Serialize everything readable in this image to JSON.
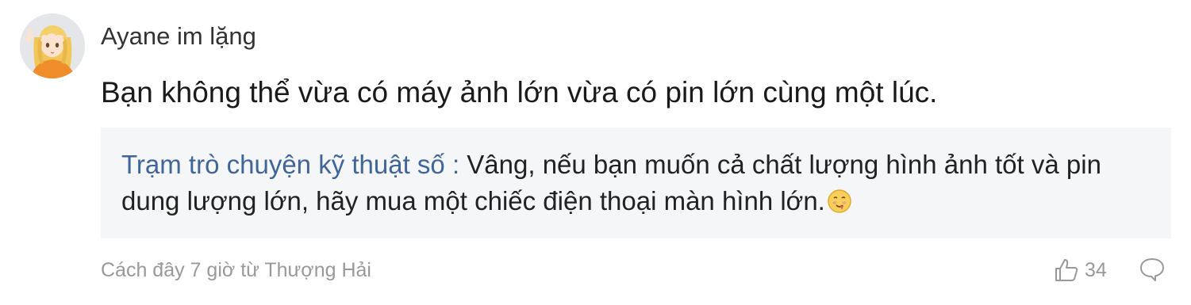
{
  "comment": {
    "username": "Ayane im lặng",
    "text": "Bạn không thể vừa có máy ảnh lớn vừa có pin lớn cùng một lúc.",
    "avatar_icon": "anime-girl-avatar",
    "reply": {
      "author": "Trạm trò chuyện kỹ thuật số",
      "separator": " : ",
      "text": "Vâng, nếu bạn muốn cả chất lượng hình ảnh tốt và pin dung lượng lớn, hãy mua một chiếc điện thoại màn hình lớn.",
      "emoji_icon": "smirk-face-emoji"
    },
    "meta": "Cách đây 7 giờ từ Thượng Hải",
    "like_count": "34",
    "like_icon": "thumbs-up-icon",
    "reply_icon": "comment-bubble-icon"
  },
  "colors": {
    "author_link": "#406599",
    "reply_bg": "#f5f6f7",
    "meta_text": "#999999"
  }
}
